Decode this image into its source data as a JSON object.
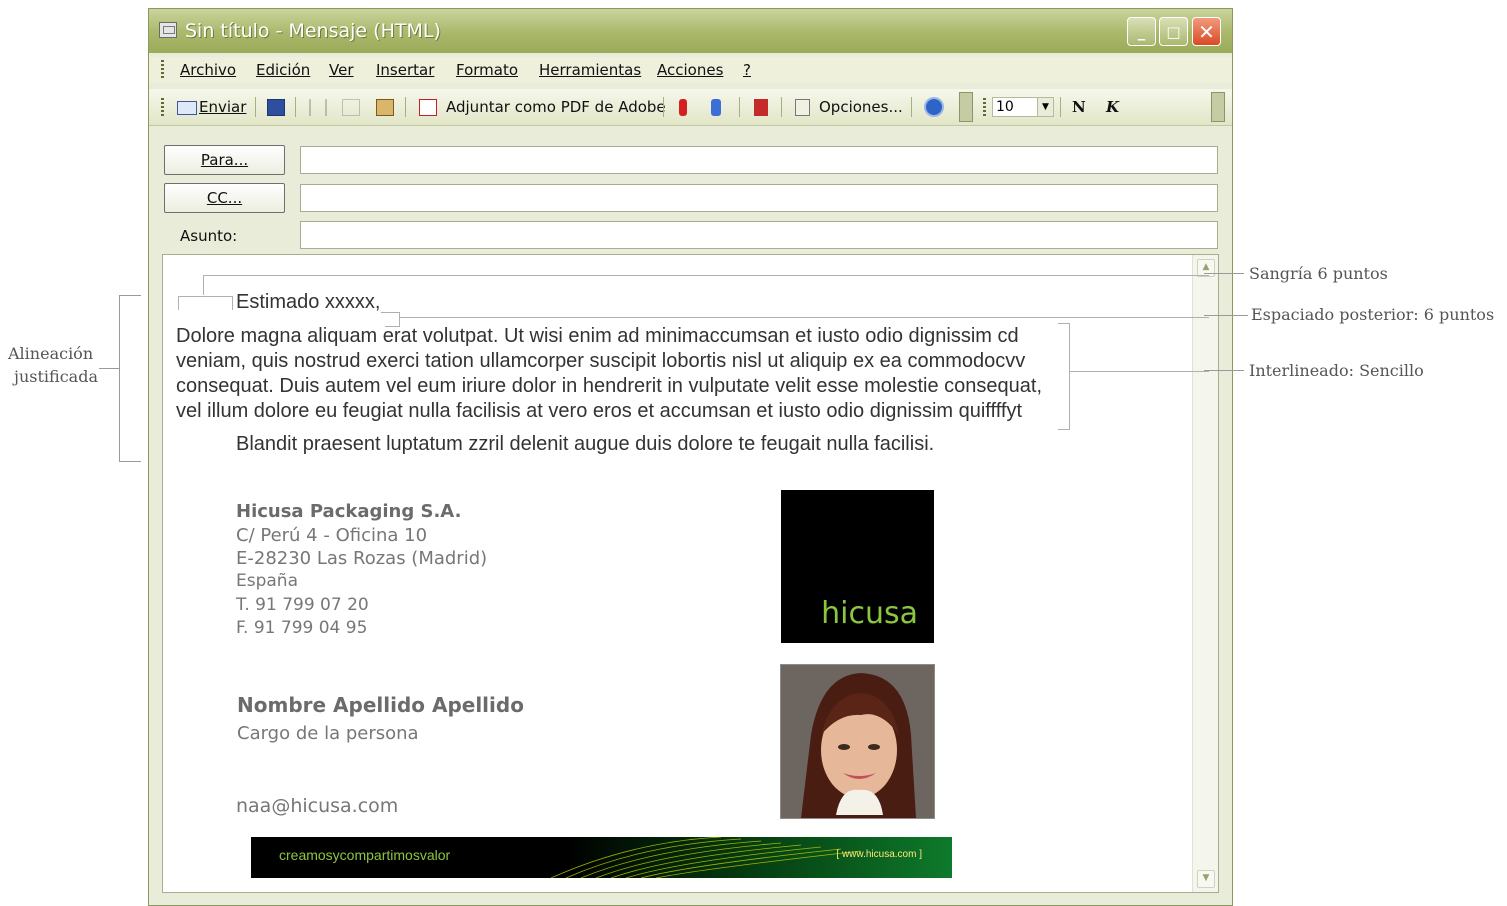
{
  "window": {
    "title": "Sin título - Mensaje (HTML)",
    "controls": {
      "minimize": "_",
      "maximize": "□",
      "close": "✕"
    }
  },
  "menu": [
    "Archivo",
    "Edición",
    "Ver",
    "Insertar",
    "Formato",
    "Herramientas",
    "Acciones",
    "?"
  ],
  "toolbar": {
    "send": "Enviar",
    "attach_pdf": "Adjuntar como PDF de Adobe",
    "options": "Opciones...",
    "font_size": "10",
    "bold": "N",
    "italic": "K"
  },
  "fields": {
    "to_button": "Para...",
    "cc_button": "CC...",
    "subject_label": "Asunto:"
  },
  "message": {
    "greeting": "Estimado xxxxx,",
    "paragraph_lines": [
      "Dolore magna aliquam erat volutpat.  Ut wisi enim ad minimaccumsan et iusto odio dignissim cd",
      "veniam, quis nostrud exerci tation ullamcorper suscipit lobortis nisl ut aliquip ex ea commodocvv",
      "consequat.  Duis autem vel eum iriure dolor in hendrerit in vulputate velit esse molestie consequat,",
      "vel illum dolore eu feugiat nulla facilisis at vero eros et accumsan et iusto odio dignissim quiffffyt"
    ],
    "closing": "Blandit praesent luptatum zzril delenit augue duis dolore te feugait nulla facilisi."
  },
  "signature": {
    "company": "Hicusa Packaging S.A.",
    "address_lines": [
      "C/ Perú 4 - Oficina 10",
      "E-28230 Las Rozas (Madrid)",
      "España"
    ],
    "phone": "T.  91 799 07 20",
    "fax": "F.  91 799 04 95",
    "name": "Nombre Apellido Apellido",
    "role": "Cargo de la persona",
    "email": "naa@hicusa.com",
    "logo_text": "hicusa",
    "banner_slogan": "creamosycompartimosvalor",
    "banner_url": "[ www.hicusa.com ]"
  },
  "annotations": {
    "left": [
      "Alineación",
      "justificada"
    ],
    "indent": "Sangría 6 puntos",
    "spacing": "Espaciado posterior: 6 puntos",
    "line_spacing": "Interlineado: Sencillo"
  },
  "colors": {
    "brand_green": "#8cc63f",
    "window_frame": "#9aab59"
  }
}
